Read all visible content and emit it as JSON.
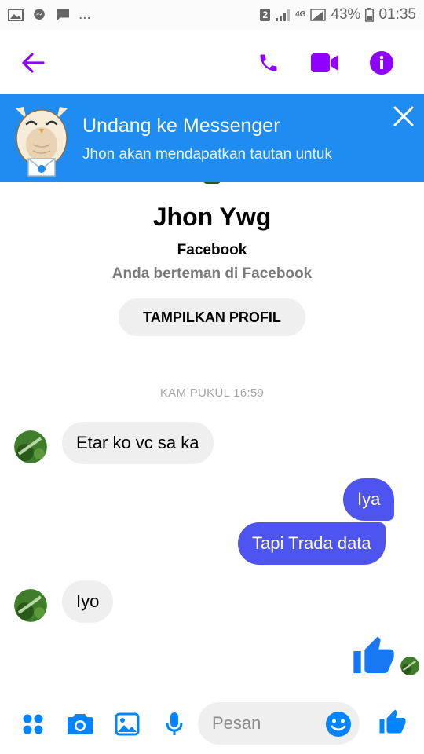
{
  "status_bar": {
    "left_icons": [
      "gallery-icon",
      "messenger-icon",
      "chat-icon"
    ],
    "more": "...",
    "sim": "2",
    "network": "4G",
    "battery": "43%",
    "time": "01:35"
  },
  "app_bar": {
    "icons": [
      "back-arrow-icon",
      "phone-icon",
      "video-camera-icon",
      "info-icon"
    ],
    "accent": "#8f00ff"
  },
  "invite": {
    "title": "Undang ke Messenger",
    "subtitle": "Jhon akan mendapatkan tautan untuk",
    "background": "#1e8cf0"
  },
  "profile": {
    "name": "Jhon Ywg",
    "source": "Facebook",
    "relation": "Anda berteman di Facebook",
    "view_profile_label": "TAMPILKAN PROFIL"
  },
  "conversation": {
    "timestamp": "KAM PUKUL 16:59",
    "messages": [
      {
        "from": "them",
        "text": "Etar ko vc sa ka"
      },
      {
        "from": "me",
        "text": "Iya"
      },
      {
        "from": "me",
        "text": "Tapi Trada data"
      },
      {
        "from": "them",
        "text": "Iyo"
      },
      {
        "from": "me",
        "type": "like",
        "icon": "thumbs-up-icon"
      }
    ],
    "outgoing_color": "#4e54f0",
    "incoming_color": "#efefef"
  },
  "composer": {
    "icons": [
      "apps-icon",
      "camera-icon",
      "image-icon",
      "microphone-icon",
      "emoji-icon",
      "thumbs-up-icon"
    ],
    "placeholder": "Pesan",
    "accent": "#0084ff"
  }
}
